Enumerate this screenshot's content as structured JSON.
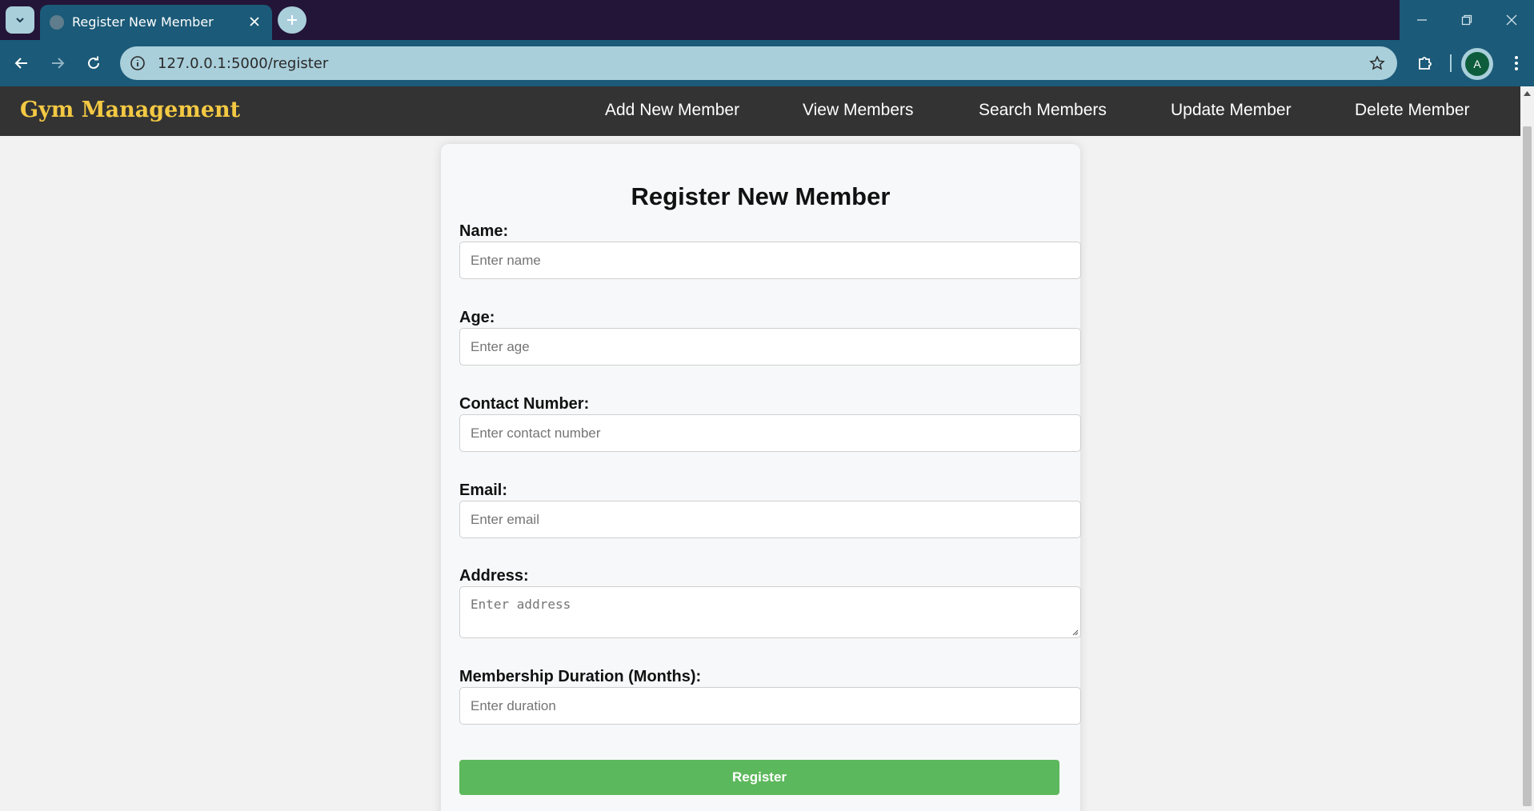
{
  "browser": {
    "tab_title": "Register New Member",
    "url": "127.0.0.1:5000/register",
    "profile_initial": "A"
  },
  "site": {
    "brand": "Gym Management",
    "nav": [
      "Add New Member",
      "View Members",
      "Search Members",
      "Update Member",
      "Delete Member"
    ]
  },
  "form": {
    "title": "Register New Member",
    "fields": [
      {
        "label": "Name:",
        "placeholder": "Enter name",
        "value": ""
      },
      {
        "label": "Age:",
        "placeholder": "Enter age",
        "value": ""
      },
      {
        "label": "Contact Number:",
        "placeholder": "Enter contact number",
        "value": ""
      },
      {
        "label": "Email:",
        "placeholder": "Enter email",
        "value": ""
      },
      {
        "label": "Address:",
        "placeholder": "Enter address",
        "value": ""
      },
      {
        "label": "Membership Duration (Months):",
        "placeholder": "Enter duration",
        "value": ""
      }
    ],
    "submit_label": "Register"
  },
  "colors": {
    "tabbar": "#231537",
    "toolbar": "#1b5a78",
    "omnibox": "#a9cfdb",
    "site_nav": "#333333",
    "brand": "#f4c943",
    "register_button": "#5cb85c"
  }
}
